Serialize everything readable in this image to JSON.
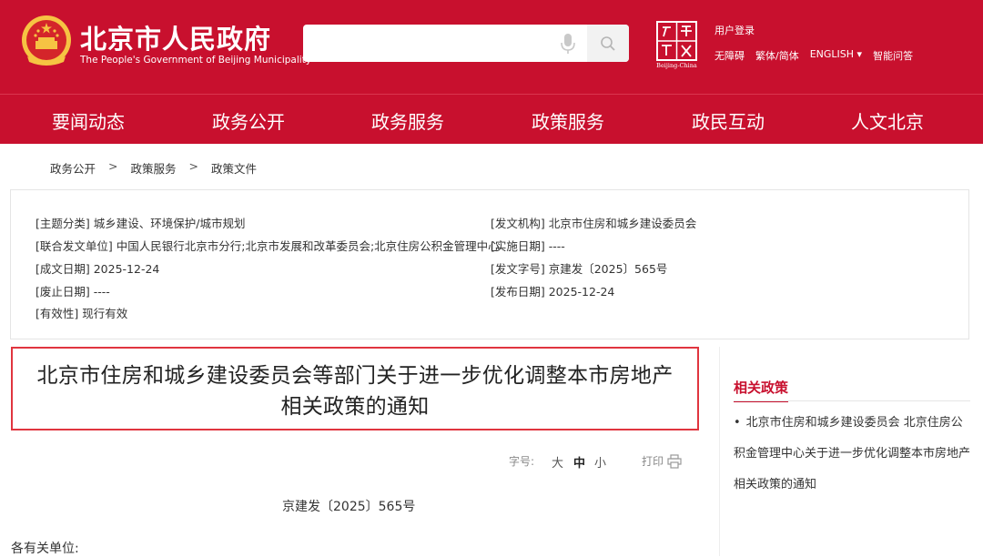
{
  "header": {
    "site_title": "北京市人民政府",
    "site_subtitle": "The People's Government of Beijing Municipality",
    "search_placeholder": "",
    "user_login": "用户登录",
    "links": [
      "无障碍",
      "繁体/简体",
      "ENGLISH ▾",
      "智能问答"
    ],
    "capital_logo_text": "Beijing-China",
    "brand_color": "#c8102e"
  },
  "nav": {
    "items": [
      "要闻动态",
      "政务公开",
      "政务服务",
      "政策服务",
      "政民互动",
      "人文北京"
    ]
  },
  "breadcrumb": {
    "items": [
      "政务公开",
      "政策服务",
      "政策文件"
    ],
    "separator": ">"
  },
  "info": {
    "topic": "[主题分类] 城乡建设、环境保护/城市规划",
    "issuer": "[发文机构] 北京市住房和城乡建设委员会",
    "co_issuer": "[联合发文单位] 中国人民银行北京市分行;北京市发展和改革委员会;北京住房公积金管理中心",
    "effective_date": "[实施日期] ----",
    "written_date": "[成文日期] 2025-12-24",
    "doc_number": "[发文字号] 京建发〔2025〕565号",
    "abolish_date": "[废止日期] ----",
    "publish_date": "[发布日期] 2025-12-24",
    "validity": "[有效性] 现行有效"
  },
  "article": {
    "title_line1": "北京市住房和城乡建设委员会等部门关于进一步优化调整本市房地产",
    "title_line2": "相关政策的通知",
    "font_size_label": "字号:",
    "size_large": "大",
    "size_medium": "中",
    "size_small": "小",
    "print_label": "打印",
    "doc_number": "京建发〔2025〕565号",
    "greeting": "各有关单位:"
  },
  "related": {
    "heading": "相关政策",
    "items": [
      "北京市住房和城乡建设委员会 北京住房公积金管理中心关于进一步优化调整本市房地产相关政策的通知"
    ]
  }
}
